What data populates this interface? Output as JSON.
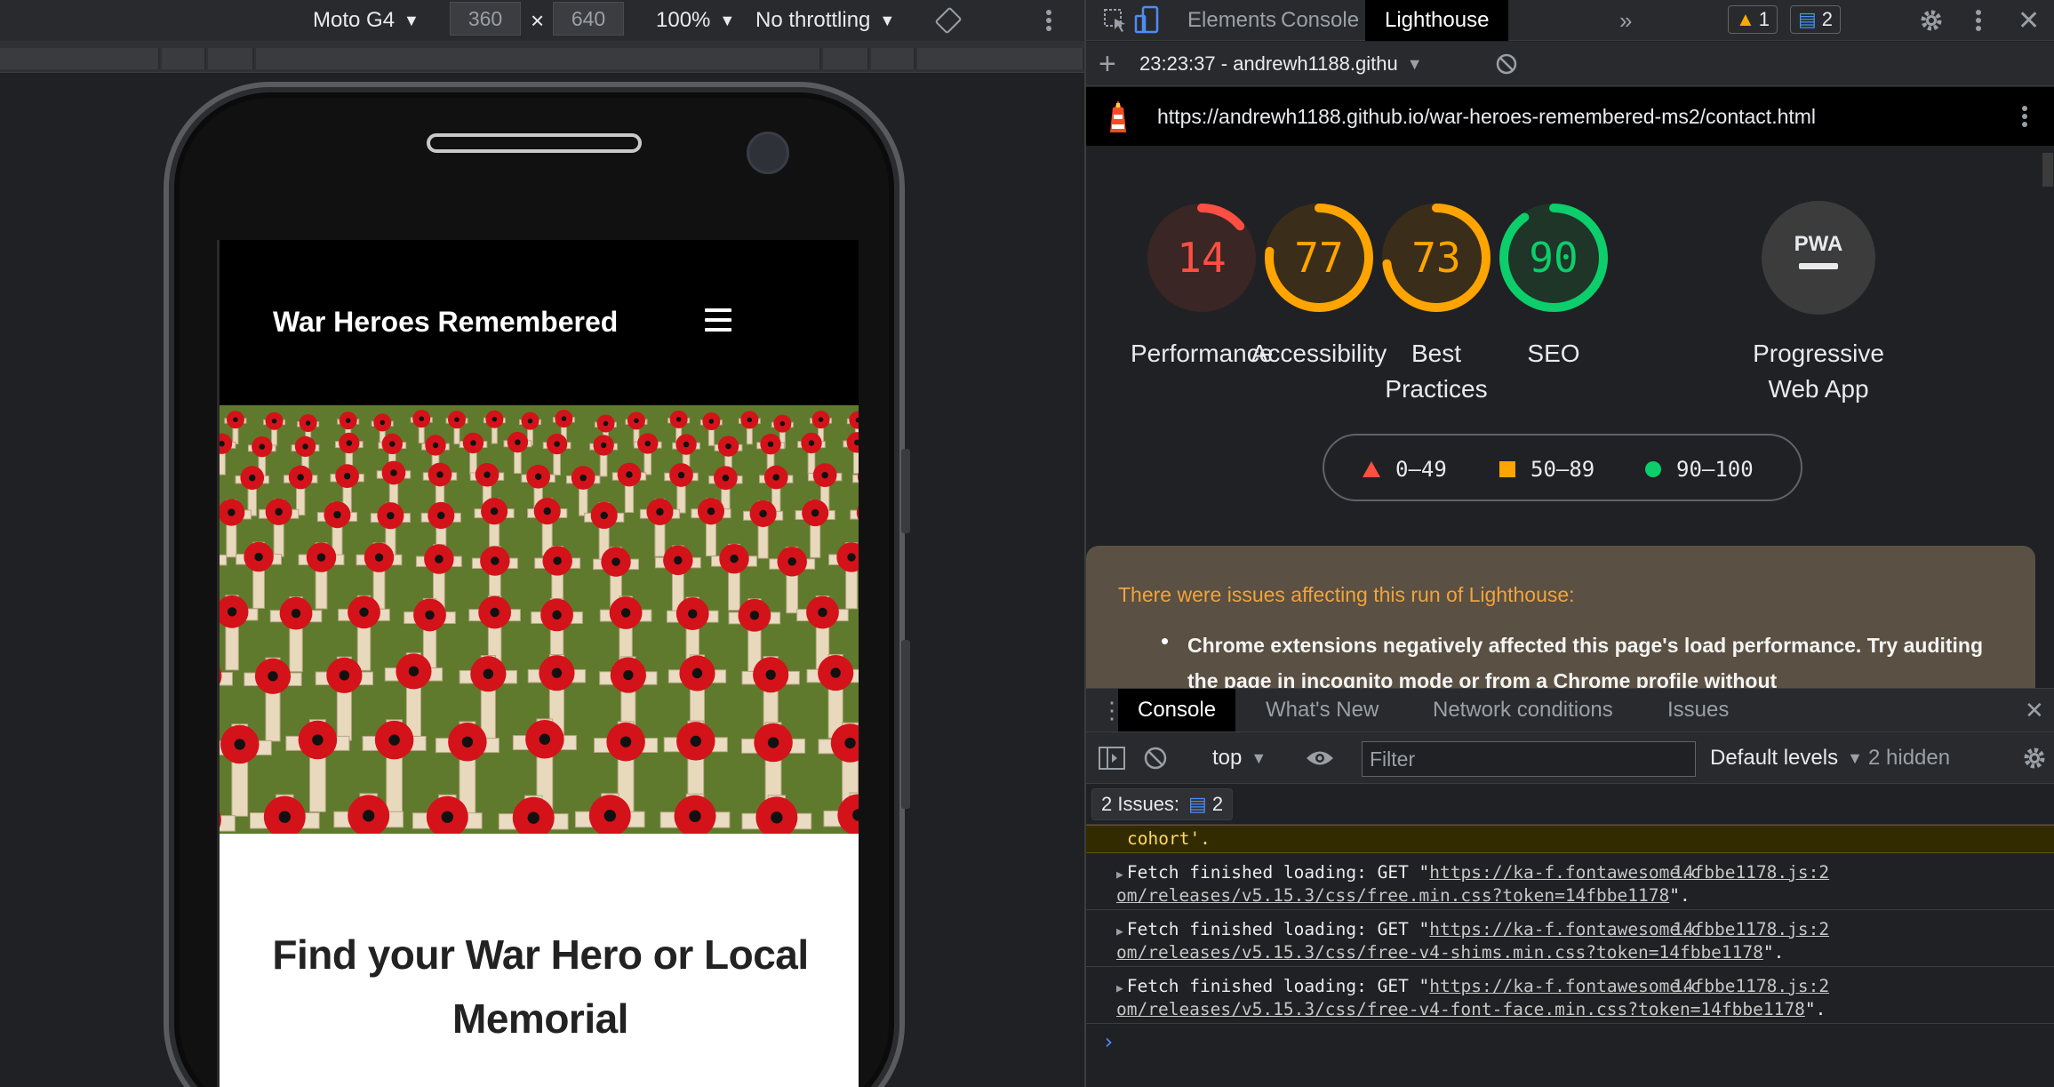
{
  "device_toolbar": {
    "device": "Moto G4",
    "width": "360",
    "times": "×",
    "height": "640",
    "zoom": "100%",
    "throttling": "No throttling"
  },
  "site": {
    "brand": "War Heroes Remembered",
    "heading": "Find your War Hero or Local Memorial"
  },
  "devtools": {
    "tabs": [
      "Elements",
      "Console",
      "Lighthouse"
    ],
    "active_tab": "Lighthouse",
    "warning_count": "1",
    "message_count": "2"
  },
  "lighthouse": {
    "report_selector": "23:23:37 - andrewh1188.githu",
    "url": "https://andrewh1188.github.io/war-heroes-remembered-ms2/contact.html",
    "categories": [
      {
        "score": 14,
        "label": "Performance",
        "color": "#ff4e42",
        "track": "#3a2624"
      },
      {
        "score": 77,
        "label": "Accessibility",
        "color": "#ffa400",
        "track": "#3a2e1a"
      },
      {
        "score": 73,
        "label": "Best Practices",
        "color": "#ffa400",
        "track": "#3a2e1a"
      },
      {
        "score": 90,
        "label": "SEO",
        "color": "#0cce6b",
        "track": "#1e3528"
      }
    ],
    "pwa": {
      "label": "Progressive Web App",
      "badge": "PWA"
    },
    "legend": {
      "fail": "0–49",
      "average": "50–89",
      "pass": "90–100"
    },
    "warning_title": "There were issues affecting this run of Lighthouse:",
    "warning_item": "Chrome extensions negatively affected this page's load performance. Try auditing the page in incognito mode or from a Chrome profile without"
  },
  "drawer": {
    "tabs": [
      "Console",
      "What's New",
      "Network conditions",
      "Issues"
    ],
    "active_tab": "Console"
  },
  "console": {
    "context": "top",
    "filter_placeholder": "Filter",
    "levels": "Default levels",
    "hidden": "2 hidden",
    "issues_label": "2 Issues:",
    "issues_count": "2",
    "warn_tail": "cohort'.",
    "messages": [
      {
        "prefix": "Fetch finished loading: GET \"",
        "url1": "https://ka-f.fontawesome.c",
        "url2": "om/releases/v5.15.3/css/free.min.css?token=14fbbe1178",
        "suffix": "\".",
        "source": "14fbbe1178.js:2"
      },
      {
        "prefix": "Fetch finished loading: GET \"",
        "url1": "https://ka-f.fontawesome.c",
        "url2": "om/releases/v5.15.3/css/free-v4-shims.min.css?token=14fbbe1178",
        "suffix": "\".",
        "source": "14fbbe1178.js:2"
      },
      {
        "prefix": "Fetch finished loading: GET \"",
        "url1": "https://ka-f.fontawesome.c",
        "url2": "om/releases/v5.15.3/css/free-v4-font-face.min.css?token=14fbbe1178",
        "suffix": "\".",
        "source": "14fbbe1178.js:2"
      }
    ]
  }
}
